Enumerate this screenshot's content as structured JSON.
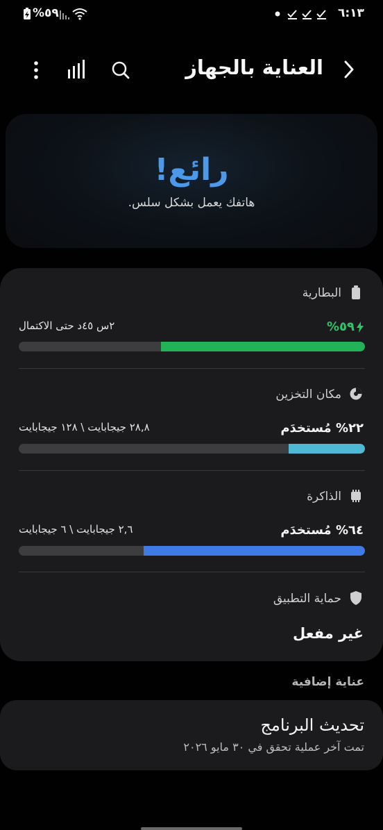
{
  "status_bar": {
    "time": "٦:١٣",
    "battery": "%٥٩",
    "notification_icons": [
      "dot-icon",
      "check-icon",
      "check-icon",
      "check-icon"
    ],
    "right_icons": [
      "battery-charging-icon",
      "signal-icon",
      "wifi-icon"
    ]
  },
  "header": {
    "title": "العناية بالجهاز",
    "icons": [
      "back-chevron-icon",
      "search-icon",
      "bar-chart-icon",
      "more-vertical-icon"
    ]
  },
  "hero": {
    "title": "رائع!",
    "subtitle": "هاتفك يعمل بشكل سلس."
  },
  "battery": {
    "label": "البطارية",
    "value": "%٥٩",
    "detail": "٢س ٤٥د حتى الاكتمال",
    "fill_percent": 59,
    "color": "#22b257"
  },
  "storage": {
    "label": "مكان التخزين",
    "value": "٢٢% مُستخدَم",
    "detail": "٢٨,٨ جيجابايت \\ ١٢٨ جيجابايت",
    "fill_percent": 22,
    "color": "#4fb8d4"
  },
  "memory": {
    "label": "الذاكرة",
    "value": "٦٤% مُستخدَم",
    "detail": "٢,٦ جيجابايت \\ ٦ جيجابايت",
    "fill_percent": 64,
    "color": "#3e7be6"
  },
  "app_protection": {
    "label": "حماية التطبيق",
    "value": "غير مفعل"
  },
  "additional_care": {
    "heading": "عناية إضافية",
    "title": "تحديث البرنامج",
    "subtitle": "تمت آخر عملية تحقق في ٣٠ مايو ٢٠٢٦"
  }
}
